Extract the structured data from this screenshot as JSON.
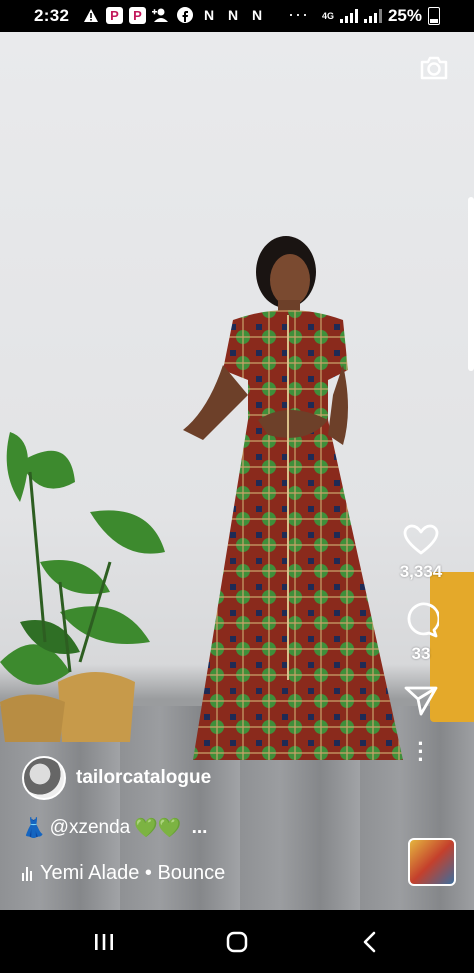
{
  "status_bar": {
    "time": "2:32",
    "left_icons": [
      "warning-icon",
      "p-app-icon",
      "p-app-icon",
      "person-add-icon",
      "facebook-icon",
      "n-app-icon",
      "n-app-icon",
      "n-app-icon"
    ],
    "p_glyph": "P",
    "n_glyph": "N",
    "network": "4G",
    "battery": "25%"
  },
  "post": {
    "likes": "3,334",
    "comments": "33",
    "username": "tailorcatalogue",
    "caption_emoji": "👗",
    "caption_mention": "@xzenda",
    "caption_hearts": "💚💚",
    "caption_more": "...",
    "music": "Yemi Alade • Bounce"
  },
  "colors": {
    "accent_white": "#ffffff",
    "pot_yellow": "#e4a92a",
    "dress_red": "#8a2a1c",
    "dress_green": "#3f8f3a"
  }
}
